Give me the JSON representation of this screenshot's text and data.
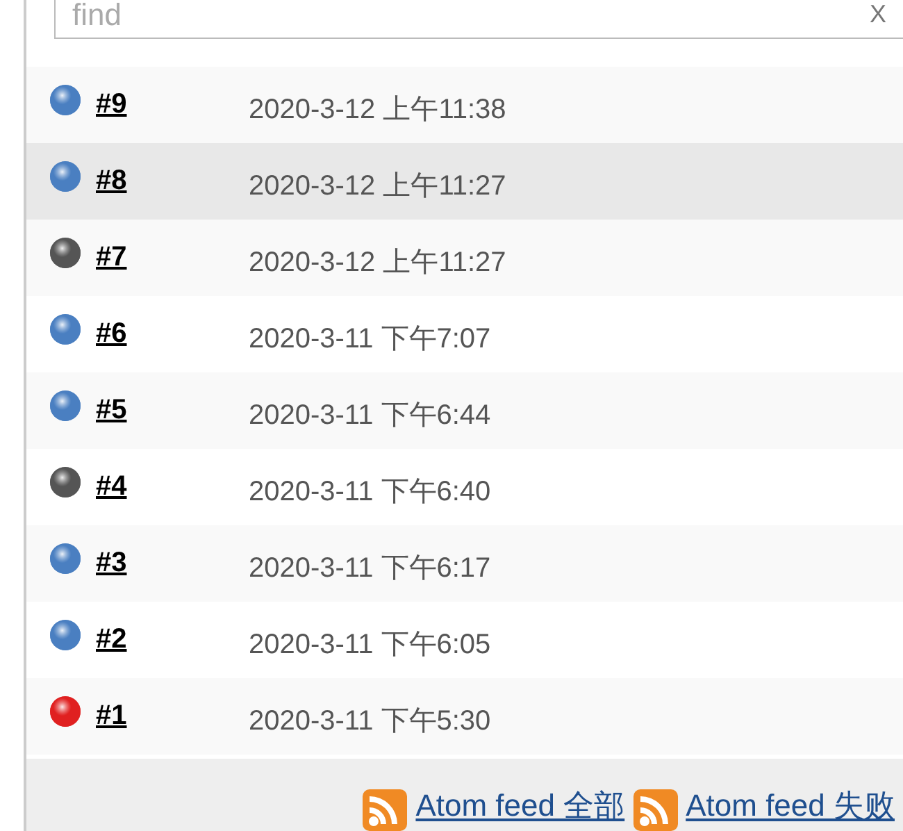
{
  "search": {
    "placeholder": "find",
    "clear": "X"
  },
  "builds": [
    {
      "number": "#9",
      "time": "2020-3-12 上午11:38",
      "color": "#4a7fc1",
      "selected": false
    },
    {
      "number": "#8",
      "time": "2020-3-12 上午11:27",
      "color": "#4a7fc1",
      "selected": true
    },
    {
      "number": "#7",
      "time": "2020-3-12 上午11:27",
      "color": "#555555",
      "selected": false
    },
    {
      "number": "#6",
      "time": "2020-3-11 下午7:07",
      "color": "#4a7fc1",
      "selected": false
    },
    {
      "number": "#5",
      "time": "2020-3-11 下午6:44",
      "color": "#4a7fc1",
      "selected": false
    },
    {
      "number": "#4",
      "time": "2020-3-11 下午6:40",
      "color": "#555555",
      "selected": false
    },
    {
      "number": "#3",
      "time": "2020-3-11 下午6:17",
      "color": "#4a7fc1",
      "selected": false
    },
    {
      "number": "#2",
      "time": "2020-3-11 下午6:05",
      "color": "#4a7fc1",
      "selected": false
    },
    {
      "number": "#1",
      "time": "2020-3-11 下午5:30",
      "color": "#e02020",
      "selected": false
    }
  ],
  "feeds": [
    "Atom feed 全部",
    "Atom feed 失败"
  ]
}
